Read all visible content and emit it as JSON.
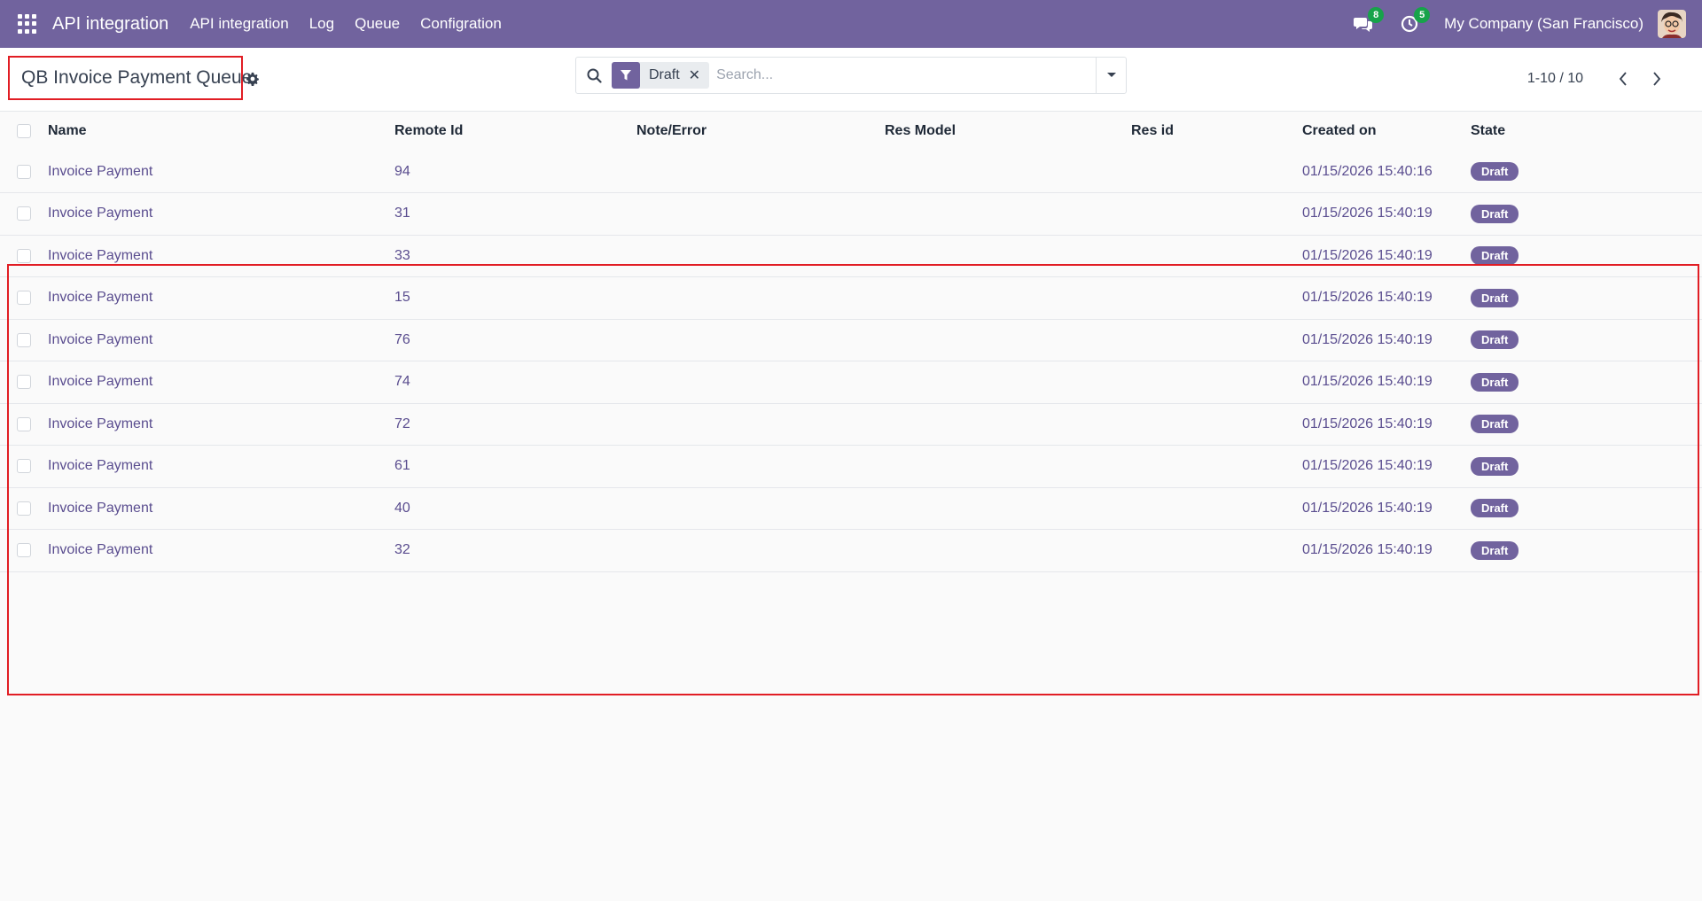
{
  "navbar": {
    "app_title": "API integration",
    "menu": [
      "API integration",
      "Log",
      "Queue",
      "Configration"
    ],
    "messages_count": "8",
    "activities_count": "5",
    "company": "My Company (San Francisco)",
    "accent_color": "#71639e"
  },
  "control_panel": {
    "title": "QB Invoice Payment Queue",
    "filter_facet": "Draft",
    "search_placeholder": "Search...",
    "pager": "1-10 / 10"
  },
  "table": {
    "headers": {
      "name": "Name",
      "remote_id": "Remote Id",
      "note": "Note/Error",
      "res_model": "Res Model",
      "res_id": "Res id",
      "created_on": "Created on",
      "state": "State"
    },
    "rows": [
      {
        "name": "Invoice Payment",
        "remote_id": "94",
        "note": "",
        "res_model": "",
        "res_id": "",
        "created_on": "01/15/2026 15:40:16",
        "state": "Draft"
      },
      {
        "name": "Invoice Payment",
        "remote_id": "31",
        "note": "",
        "res_model": "",
        "res_id": "",
        "created_on": "01/15/2026 15:40:19",
        "state": "Draft"
      },
      {
        "name": "Invoice Payment",
        "remote_id": "33",
        "note": "",
        "res_model": "",
        "res_id": "",
        "created_on": "01/15/2026 15:40:19",
        "state": "Draft"
      },
      {
        "name": "Invoice Payment",
        "remote_id": "15",
        "note": "",
        "res_model": "",
        "res_id": "",
        "created_on": "01/15/2026 15:40:19",
        "state": "Draft"
      },
      {
        "name": "Invoice Payment",
        "remote_id": "76",
        "note": "",
        "res_model": "",
        "res_id": "",
        "created_on": "01/15/2026 15:40:19",
        "state": "Draft"
      },
      {
        "name": "Invoice Payment",
        "remote_id": "74",
        "note": "",
        "res_model": "",
        "res_id": "",
        "created_on": "01/15/2026 15:40:19",
        "state": "Draft"
      },
      {
        "name": "Invoice Payment",
        "remote_id": "72",
        "note": "",
        "res_model": "",
        "res_id": "",
        "created_on": "01/15/2026 15:40:19",
        "state": "Draft"
      },
      {
        "name": "Invoice Payment",
        "remote_id": "61",
        "note": "",
        "res_model": "",
        "res_id": "",
        "created_on": "01/15/2026 15:40:19",
        "state": "Draft"
      },
      {
        "name": "Invoice Payment",
        "remote_id": "40",
        "note": "",
        "res_model": "",
        "res_id": "",
        "created_on": "01/15/2026 15:40:19",
        "state": "Draft"
      },
      {
        "name": "Invoice Payment",
        "remote_id": "32",
        "note": "",
        "res_model": "",
        "res_id": "",
        "created_on": "01/15/2026 15:40:19",
        "state": "Draft"
      }
    ]
  }
}
